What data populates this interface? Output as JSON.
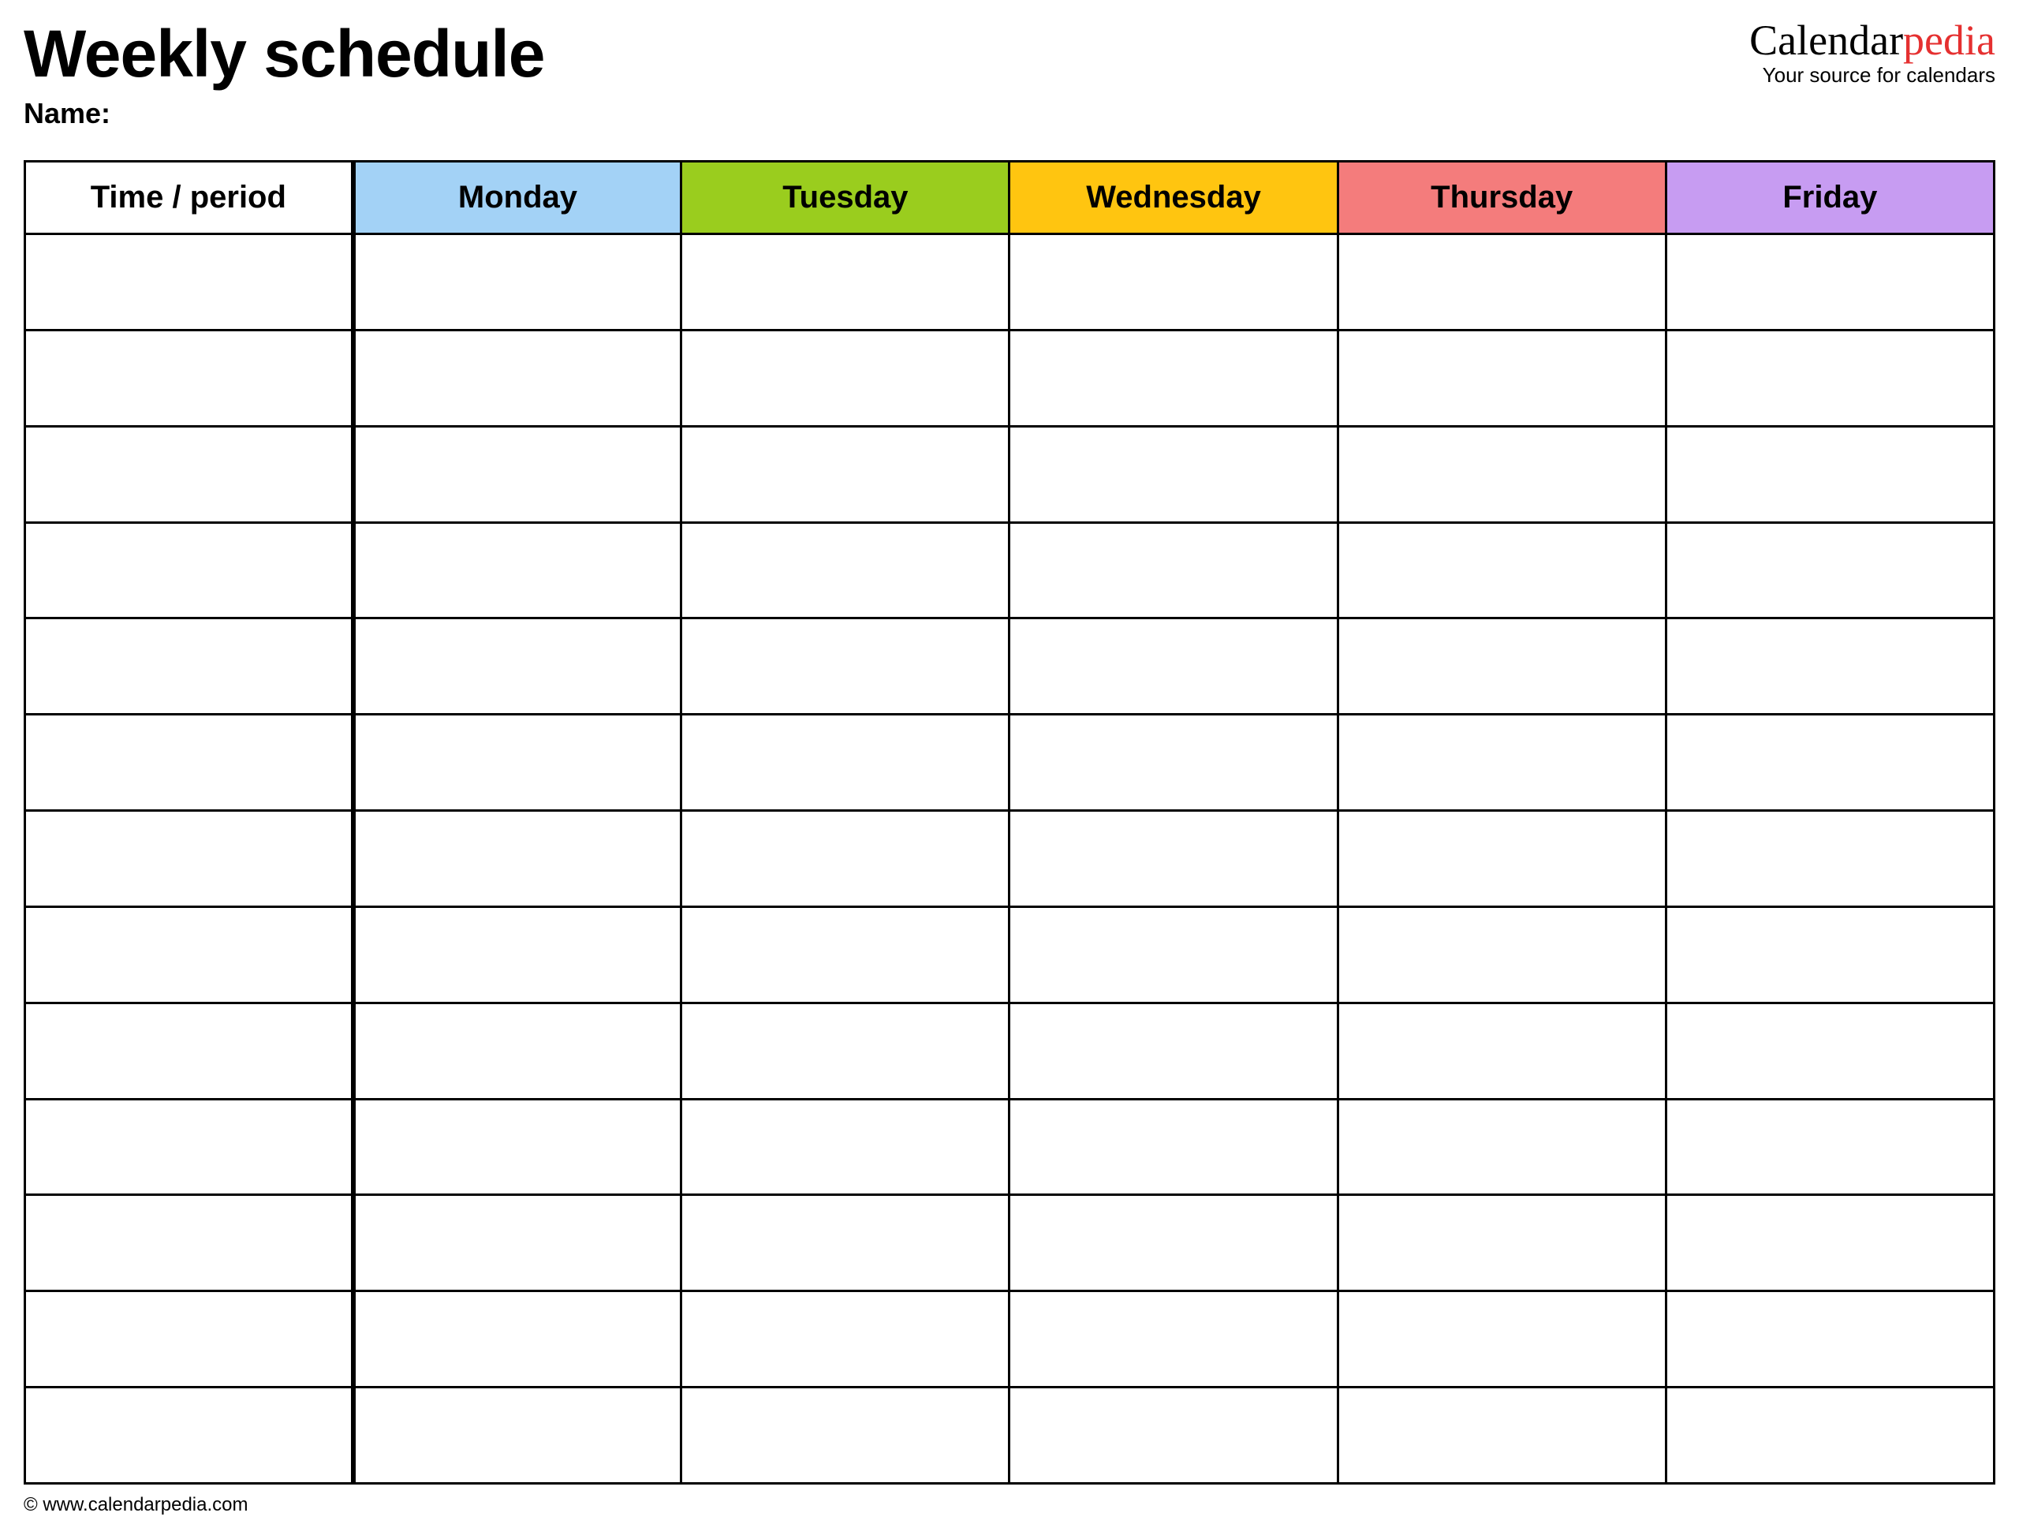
{
  "header": {
    "title": "Weekly schedule",
    "name_label": "Name:"
  },
  "brand": {
    "part1": "Calendar",
    "part2": "pedia",
    "tagline": "Your source for calendars"
  },
  "columns": {
    "time": "Time / period",
    "days": [
      {
        "label": "Monday",
        "color": "#a3d2f6"
      },
      {
        "label": "Tuesday",
        "color": "#9acd1e"
      },
      {
        "label": "Wednesday",
        "color": "#ffc510"
      },
      {
        "label": "Thursday",
        "color": "#f47c7c"
      },
      {
        "label": "Friday",
        "color": "#c79cf2"
      }
    ]
  },
  "row_count": 13,
  "footer": "© www.calendarpedia.com"
}
